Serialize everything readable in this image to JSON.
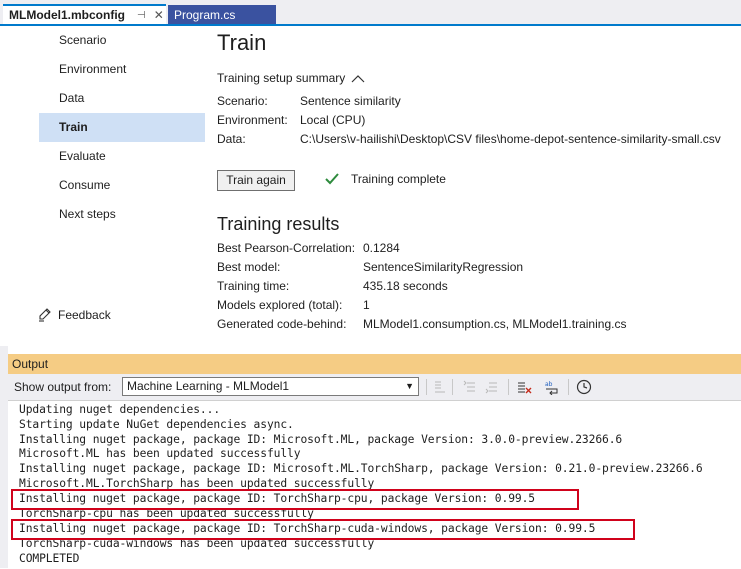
{
  "tabs": [
    {
      "label": "MLModel1.mbconfig",
      "pin": "⊣",
      "close": "✕"
    },
    {
      "label": "Program.cs"
    }
  ],
  "nav": {
    "items": [
      {
        "label": "Scenario"
      },
      {
        "label": "Environment"
      },
      {
        "label": "Data"
      },
      {
        "label": "Train"
      },
      {
        "label": "Evaluate"
      },
      {
        "label": "Consume"
      },
      {
        "label": "Next steps"
      }
    ],
    "feedback_label": "Feedback"
  },
  "main": {
    "title": "Train",
    "summary_header": "Training setup summary",
    "summary": [
      {
        "key": "Scenario:",
        "value": "Sentence similarity"
      },
      {
        "key": "Environment:",
        "value": "Local (CPU)"
      },
      {
        "key": "Data:",
        "value": "C:\\Users\\v-hailishi\\Desktop\\CSV files\\home-depot-sentence-similarity-small.csv"
      }
    ],
    "train_again_label": "Train again",
    "status_text": "Training complete",
    "results_title": "Training results",
    "results": [
      {
        "key": "Best Pearson-Correlation:",
        "value": "0.1284"
      },
      {
        "key": "Best model:",
        "value": "SentenceSimilarityRegression"
      },
      {
        "key": "Training time:",
        "value": "435.18 seconds"
      },
      {
        "key": "Models explored (total):",
        "value": "1"
      },
      {
        "key": "Generated code-behind:",
        "value": "MLModel1.consumption.cs, MLModel1.training.cs"
      }
    ]
  },
  "output": {
    "title": "Output",
    "show_from_label": "Show output from:",
    "source": "Machine Learning - MLModel1",
    "lines": [
      "Updating nuget dependencies...",
      "Starting update NuGet dependencies async.",
      "Installing nuget package, package ID: Microsoft.ML, package Version: 3.0.0-preview.23266.6",
      "Microsoft.ML has been updated successfully",
      "Installing nuget package, package ID: Microsoft.ML.TorchSharp, package Version: 0.21.0-preview.23266.6",
      "Microsoft.ML.TorchSharp has been updated successfully",
      "Installing nuget package, package ID: TorchSharp-cpu, package Version: 0.99.5",
      "TorchSharp-cpu has been updated successfully",
      "Installing nuget package, package ID: TorchSharp-cuda-windows, package Version: 0.99.5",
      "TorchSharp-cuda-windows has been updated successfully",
      "COMPLETED"
    ]
  },
  "colors": {
    "accent": "#007acc",
    "nav_active": "#cfe0f5",
    "output_header": "#f5cc84",
    "highlight": "#d0021b",
    "check": "#2e8b3d"
  }
}
